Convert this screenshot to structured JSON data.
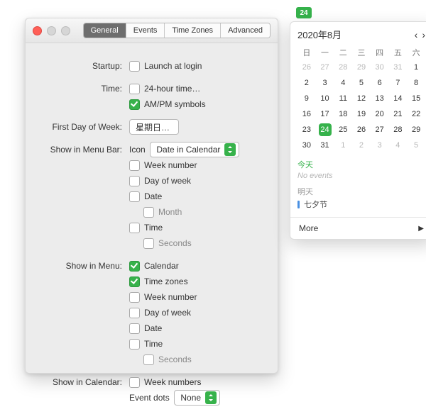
{
  "tabs": [
    "General",
    "Events",
    "Time Zones",
    "Advanced"
  ],
  "activeTab": 0,
  "labels": {
    "startup": "Startup:",
    "time": "Time:",
    "firstday": "First Day of Week:",
    "menubar": "Show in Menu Bar:",
    "menu": "Show in Menu:",
    "calendar": "Show in Calendar:"
  },
  "texts": {
    "launch": "Launch at login",
    "t24": "24-hour time…",
    "ampm": "AM/PM symbols",
    "firstday_value": "星期日…",
    "iconlbl": "Icon",
    "iconsel": "Date in Calendar",
    "weeknum": "Week number",
    "dow": "Day of week",
    "date": "Date",
    "month": "Month",
    "time": "Time",
    "seconds": "Seconds",
    "cal": "Calendar",
    "tz": "Time zones",
    "weeknums": "Week numbers",
    "evdots": "Event dots",
    "none": "None"
  },
  "menubar_badge": "24",
  "calendar": {
    "title": "2020年8月",
    "dow": [
      "日",
      "一",
      "二",
      "三",
      "四",
      "五",
      "六"
    ],
    "rows": [
      [
        "26",
        "27",
        "28",
        "29",
        "30",
        "31",
        "1"
      ],
      [
        "2",
        "3",
        "4",
        "5",
        "6",
        "7",
        "8"
      ],
      [
        "9",
        "10",
        "11",
        "12",
        "13",
        "14",
        "15"
      ],
      [
        "16",
        "17",
        "18",
        "19",
        "20",
        "21",
        "22"
      ],
      [
        "23",
        "24",
        "25",
        "26",
        "27",
        "28",
        "29"
      ],
      [
        "30",
        "31",
        "1",
        "2",
        "3",
        "4",
        "5"
      ]
    ],
    "today_row": 4,
    "today_col": 1,
    "sections": {
      "today_label": "今天",
      "no_events": "No events",
      "tomorrow_label": "明天",
      "event1": "七夕节"
    },
    "more": "More"
  }
}
